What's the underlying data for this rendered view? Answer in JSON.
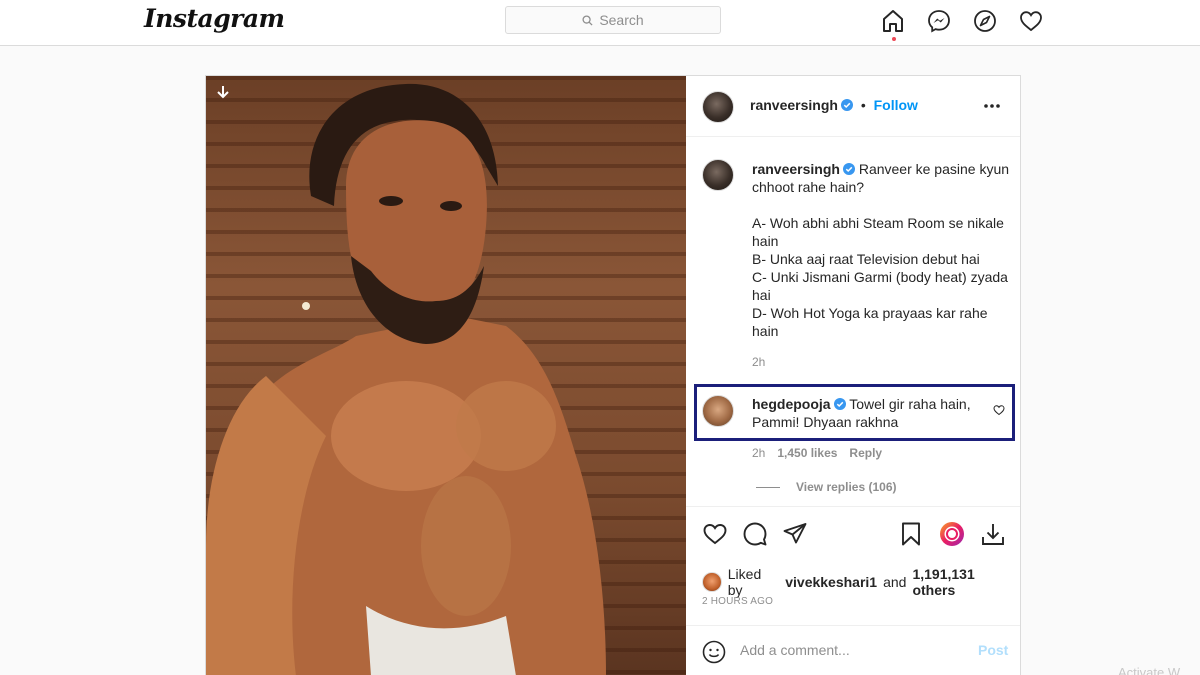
{
  "header": {
    "logo": "Instagram",
    "search_placeholder": "Search"
  },
  "post": {
    "author": "ranveersingh",
    "follow_label": "Follow",
    "separator": "•",
    "caption": {
      "author": "ranveersingh",
      "text": "Ranveer ke pasine kyun chhoot rahe hain?\n\nA- Woh abhi abhi Steam Room se nikale hain\nB- Unka aaj raat Television debut hai\nC- Unki Jismani Garmi (body heat) zyada hai\nD- Woh Hot Yoga ka prayaas kar rahe hain",
      "time": "2h"
    },
    "highlighted_comment": {
      "author": "hegdepooja",
      "text": "Towel gir raha hain, Pammi! Dhyaan rakhna",
      "time": "2h",
      "likes": "1,450 likes",
      "reply_label": "Reply",
      "view_replies": "View replies (106)"
    },
    "likes": {
      "prefix": "Liked by",
      "user": "vivekkeshari1",
      "joiner": "and",
      "count": "1,191,131 others"
    },
    "posted_time": "2 HOURS AGO",
    "add_comment_placeholder": "Add a comment...",
    "post_button": "Post"
  },
  "watermark": "Activate W",
  "colors": {
    "accent": "#0095f6",
    "highlight_border": "#1b1f7a",
    "notification_dot": "#ed4956"
  }
}
